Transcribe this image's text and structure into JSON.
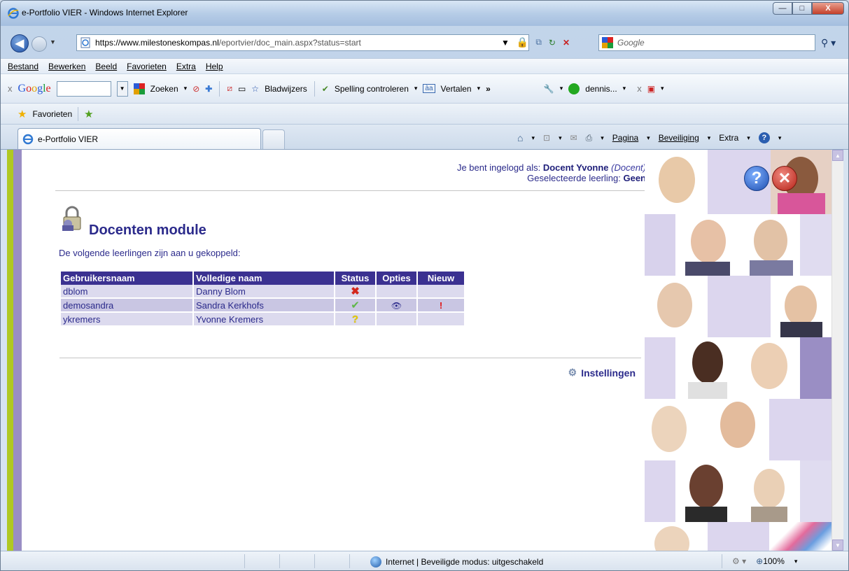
{
  "window": {
    "title": "e-Portfolio VIER - Windows Internet Explorer",
    "min_label": "—",
    "max_label": "□",
    "close_label": "X"
  },
  "address": {
    "url_host": "https://www.milestoneskompas.nl",
    "url_rest": "/eportvier/doc_main.aspx?status=start",
    "search_placeholder": "Google"
  },
  "menu": [
    "Bestand",
    "Bewerken",
    "Beeld",
    "Favorieten",
    "Extra",
    "Help"
  ],
  "google_toolbar": {
    "close": "x",
    "logo": "Google",
    "search_label": "Zoeken",
    "bookmarks_label": "Bladwijzers",
    "spelling_label": "Spelling controleren",
    "translate_label": "Vertalen",
    "more": "»",
    "user_label": "dennis...",
    "close2": "x"
  },
  "favorites": {
    "label": "Favorieten"
  },
  "tab": {
    "title": "e-Portfolio VIER"
  },
  "command_bar": {
    "page": "Pagina",
    "security": "Beveiliging",
    "extra": "Extra"
  },
  "page": {
    "login_prefix": "Je bent ingelogd als: ",
    "login_user": "Docent Yvonne",
    "login_role": "(Docent)",
    "selected_prefix": "Geselecteerde leerling: ",
    "selected_value": "Geen",
    "module_title": "Docenten module",
    "intro": "De volgende leerlingen zijn aan u gekoppeld:",
    "settings_label": "Instellingen"
  },
  "table": {
    "headers": [
      "Gebruikersnaam",
      "Volledige naam",
      "Status",
      "Opties",
      "Nieuw"
    ],
    "rows": [
      {
        "username": "dblom",
        "fullname": "Danny Blom",
        "status": "✖",
        "status_type": "inactive",
        "options": "",
        "new": ""
      },
      {
        "username": "demosandra",
        "fullname": "Sandra Kerkhofs",
        "status": "✔",
        "status_type": "active",
        "options": "👁",
        "new": "!"
      },
      {
        "username": "ykremers",
        "fullname": "Yvonne Kremers",
        "status": "?",
        "status_type": "pending",
        "options": "",
        "new": ""
      }
    ]
  },
  "status_bar": {
    "zone": "Internet | Beveiligde modus: uitgeschakeld",
    "zoom": "100%"
  },
  "colors": {
    "accent": "#2b2a8b",
    "header_bg": "#3b3191",
    "row_light": "#dcdaee",
    "row_dark": "#c9c6e3",
    "stripe_green": "#b0c822",
    "stripe_purple": "#9a8ec4"
  }
}
